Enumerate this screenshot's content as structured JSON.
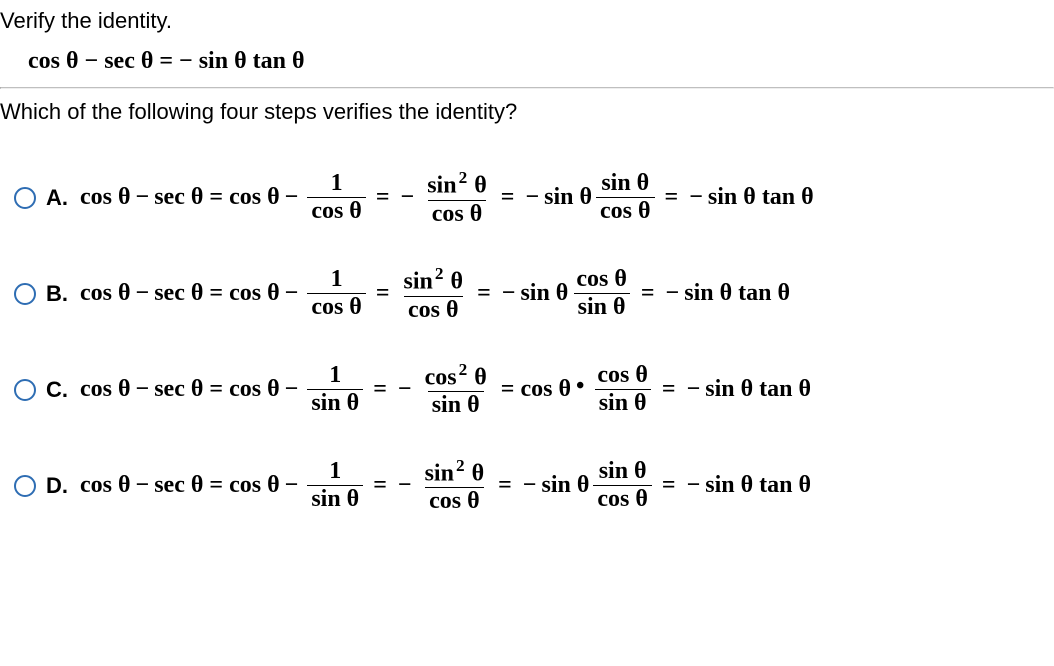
{
  "prompt": "Verify the identity.",
  "identity": "cos θ − sec θ = − sin θ tan θ",
  "question": "Which of the following four steps verifies the identity?",
  "theta": "θ",
  "sym": {
    "eq": "=",
    "minus": "−",
    "dot": "•"
  },
  "txt": {
    "cos": "cos",
    "sin": "sin",
    "sec": "sec",
    "tan": "tan",
    "one": "1",
    "two": "2"
  },
  "options": {
    "A": {
      "label": "A.",
      "chart_step": "cos θ − sec θ = cos θ − 1/cos θ = − sin² θ / cos θ = − sin θ · (sin θ / cos θ) = − sin θ tan θ",
      "frac1": {
        "num": "1",
        "den": "cos θ"
      },
      "frac2_num_sup": "2",
      "frac2_num_base": "sin",
      "frac2_den": "cos θ",
      "mid_fn": "sin",
      "frac3": {
        "num": "sin θ",
        "den": "cos θ"
      },
      "sign2": "−",
      "sign3": "−",
      "sep": " "
    },
    "B": {
      "label": "B.",
      "chart_step": "cos θ − sec θ = cos θ − 1/cos θ = sin² θ / cos θ = − sin θ · (cos θ / sin θ) = − sin θ tan θ",
      "frac1": {
        "num": "1",
        "den": "cos θ"
      },
      "frac2_num_sup": "2",
      "frac2_num_base": "sin",
      "frac2_den": "cos θ",
      "mid_fn": "sin",
      "frac3": {
        "num": "cos θ",
        "den": "sin θ"
      },
      "sign2": "",
      "sign3": "−",
      "sep": " "
    },
    "C": {
      "label": "C.",
      "chart_step": "cos θ − sec θ = cos θ − 1/sin θ = − cos² θ / sin θ = cos θ · (cos θ / sin θ) = − sin θ tan θ",
      "frac1": {
        "num": "1",
        "den": "sin θ"
      },
      "frac2_num_sup": "2",
      "frac2_num_base": "cos",
      "frac2_den": "sin θ",
      "mid_fn": "cos",
      "frac3": {
        "num": "cos θ",
        "den": "sin θ"
      },
      "sign2": "−",
      "sign3": "",
      "sep": "•"
    },
    "D": {
      "label": "D.",
      "chart_step": "cos θ − sec θ = cos θ − 1/sin θ = − sin² θ / cos θ = − sin θ · (sin θ / cos θ) = − sin θ tan θ",
      "frac1": {
        "num": "1",
        "den": "sin θ"
      },
      "frac2_num_sup": "2",
      "frac2_num_base": "sin",
      "frac2_den": "cos θ",
      "mid_fn": "sin",
      "frac3": {
        "num": "sin θ",
        "den": "cos θ"
      },
      "sign2": "−",
      "sign3": "−",
      "sep": " "
    }
  }
}
